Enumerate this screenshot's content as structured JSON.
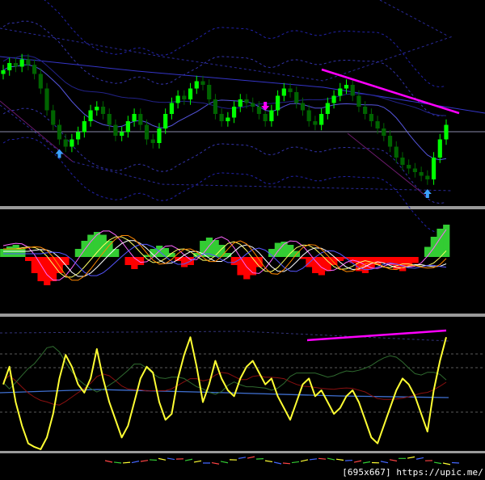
{
  "watermark": "[695x667] https://upic.me/",
  "colors": {
    "background": "#000000",
    "bull_candle": "#00ff00",
    "bear_candle": "#006400",
    "divergence_line": "#ff00ff",
    "arrow_up": "#3aa0ff",
    "arrow_down": "#ff00ff",
    "hist_positive": "#33cc33",
    "hist_negative": "#ff0000",
    "osc_main": "#ffff33",
    "separator": "#9a9a9a"
  },
  "chart_data": [
    {
      "type": "candlestick",
      "panel": "price",
      "title": "",
      "grid": false,
      "y_range": [
        0,
        100
      ],
      "close": [
        68,
        72,
        70,
        74,
        71,
        66,
        58,
        46,
        38,
        30,
        26,
        30,
        34,
        40,
        46,
        48,
        44,
        38,
        32,
        34,
        40,
        44,
        38,
        30,
        28,
        36,
        44,
        50,
        54,
        52,
        58,
        62,
        60,
        52,
        44,
        40,
        42,
        48,
        52,
        50,
        48,
        44,
        40,
        46,
        54,
        58,
        56,
        50,
        46,
        40,
        38,
        44,
        50,
        54,
        58,
        60,
        54,
        48,
        44,
        40,
        36,
        32,
        26,
        20,
        16,
        14,
        12,
        10,
        8,
        20,
        30,
        38
      ],
      "markers": [
        {
          "type": "arrow-up",
          "index": 9
        },
        {
          "type": "arrow-down",
          "index": 42
        },
        {
          "type": "arrow-up",
          "index": 68
        }
      ],
      "divergence_line": {
        "from_index": 45,
        "to_index": 71
      },
      "horizontal_level": 50
    },
    {
      "type": "histogram-lines",
      "panel": "oscillator-1",
      "title": "",
      "grid": false,
      "y_range": [
        -100,
        100
      ],
      "histogram": [
        20,
        26,
        30,
        20,
        -10,
        -40,
        -60,
        -70,
        -60,
        -40,
        -20,
        0,
        20,
        40,
        55,
        62,
        55,
        40,
        20,
        0,
        -20,
        -30,
        -20,
        5,
        20,
        28,
        22,
        10,
        -10,
        -25,
        -20,
        10,
        40,
        48,
        42,
        30,
        10,
        -20,
        -45,
        -55,
        -45,
        -25,
        0,
        20,
        35,
        38,
        30,
        15,
        -5,
        -25,
        -40,
        -45,
        -35,
        -20,
        -10,
        -5,
        -15,
        -35,
        -40,
        -30,
        -20,
        -15,
        -20,
        -30,
        -35,
        -25,
        -15,
        0,
        25,
        50,
        70,
        80
      ]
    },
    {
      "type": "line",
      "panel": "oscillator-2",
      "title": "",
      "grid": false,
      "y_range": [
        0,
        100
      ],
      "series": [
        {
          "values": [
            55,
            70,
            40,
            20,
            5,
            2,
            0,
            10,
            30,
            60,
            80,
            70,
            55,
            48,
            60,
            85,
            60,
            40,
            25,
            10,
            20,
            40,
            60,
            70,
            65,
            40,
            25,
            30,
            60,
            80,
            95,
            70,
            40,
            55,
            75,
            60,
            50,
            45,
            60,
            70,
            75,
            65,
            55,
            60,
            45,
            35,
            25,
            40,
            55,
            60,
            45,
            50,
            40,
            30,
            35,
            45,
            50,
            40,
            25,
            10,
            5,
            20,
            35,
            50,
            60,
            55,
            45,
            30,
            15,
            50,
            75,
            95
          ]
        }
      ],
      "divergence_line": {
        "from_index": 45,
        "to_index": 71
      }
    }
  ]
}
